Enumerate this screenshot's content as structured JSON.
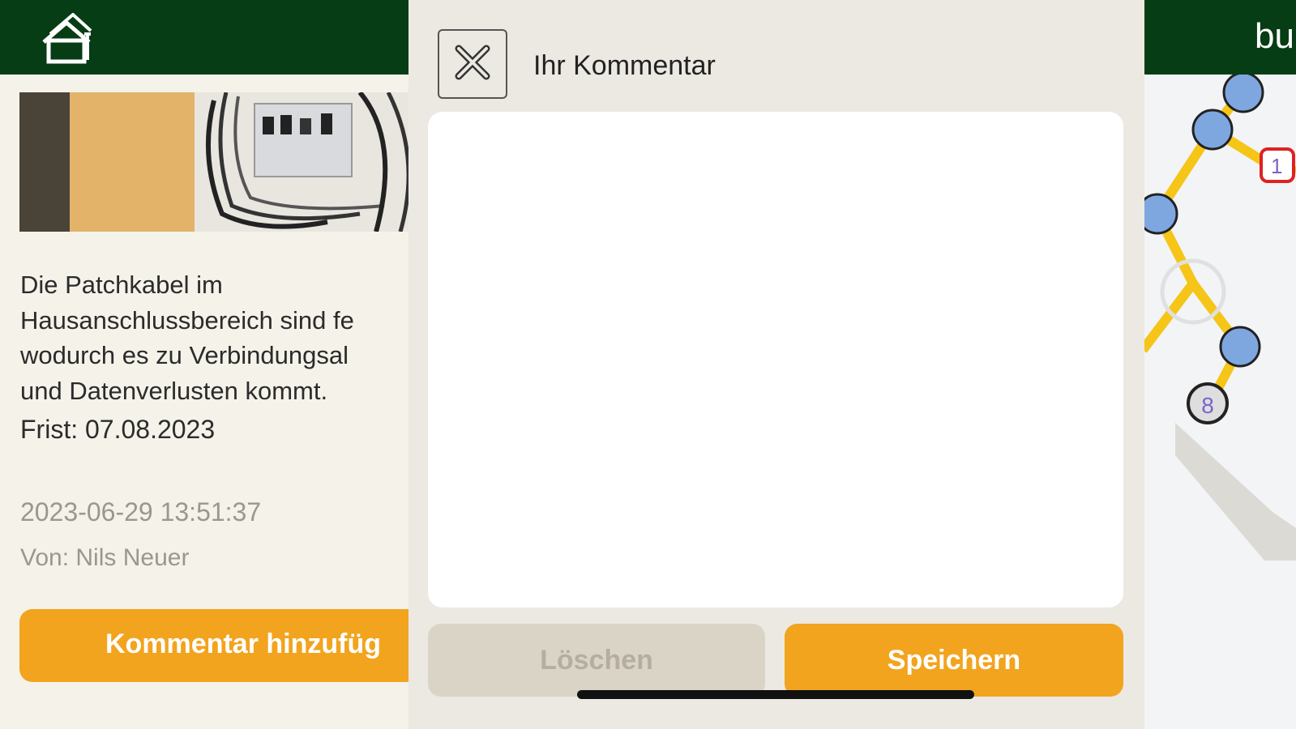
{
  "header": {
    "brand_text_partial": "bu"
  },
  "issue": {
    "description": "Die Patchkabel im\nHausanschlussbereich sind fe\nwodurch es zu Verbindungsal\nund Datenverlusten kommt.",
    "deadline": "Frist: 07.08.2023",
    "timestamp": "2023-06-29 13:51:37",
    "author": "Von: Nils Neuer",
    "add_comment_label": "Kommentar hinzufüg"
  },
  "map": {
    "marker_labels": [
      "1",
      "8"
    ]
  },
  "modal": {
    "title": "Ihr Kommentar",
    "comment_value": "",
    "delete_label": "Löschen",
    "save_label": "Speichern"
  },
  "colors": {
    "header_green": "#063d14",
    "accent_orange": "#f2a41e",
    "disabled_beige": "#dad4c7",
    "node_blue": "#7ea7e0",
    "route_yellow": "#f5c518"
  },
  "icons": [
    "home-icon",
    "close-icon"
  ]
}
